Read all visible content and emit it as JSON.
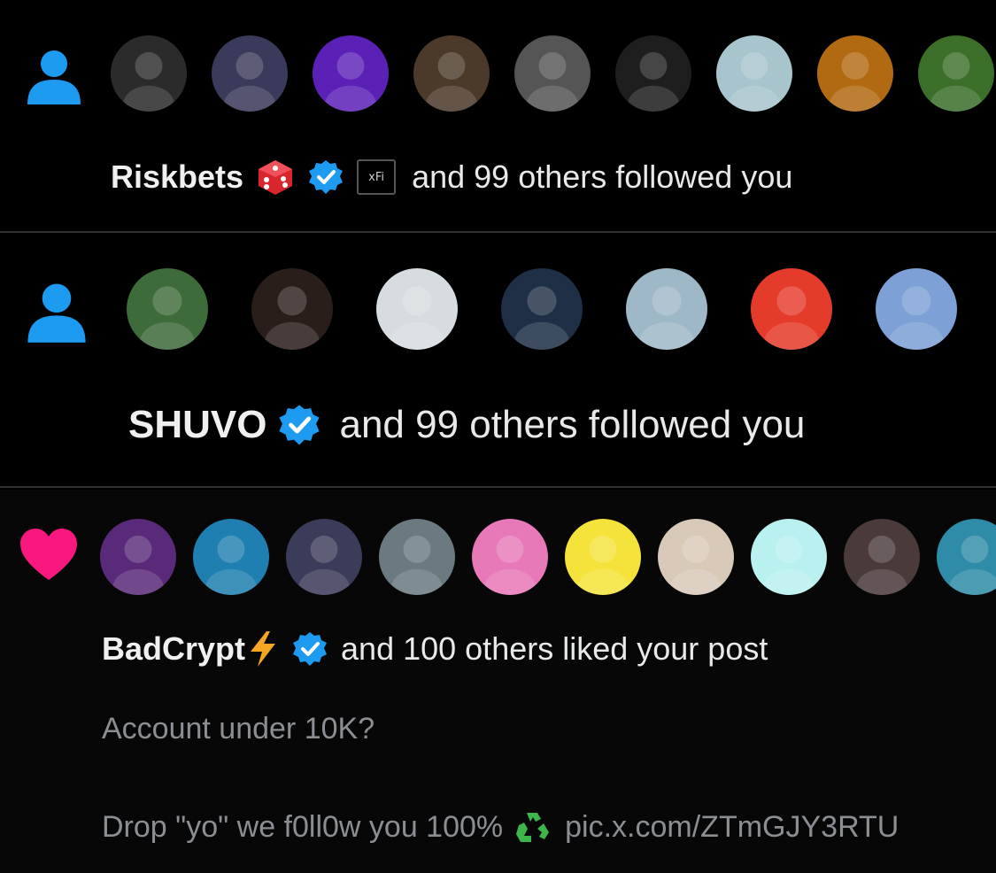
{
  "notifications": [
    {
      "type": "follow",
      "icon": "person-icon",
      "user": "Riskbets",
      "emoji": "🎲",
      "badge_text": "xFi",
      "text": "and 99 others followed you",
      "avatars": [
        "#2b2b2b",
        "#3a3a5a",
        "#5b21b6",
        "#4b3a2a",
        "#555555",
        "#1e1e1e",
        "#a8c4cc",
        "#b26a12",
        "#3b6f2a"
      ]
    },
    {
      "type": "follow",
      "icon": "person-icon",
      "user": "SHUVO",
      "text": "and 99 others followed you",
      "avatars": [
        "#3d6b3a",
        "#2a1e1a",
        "#d6dce0",
        "#1f2f45",
        "#9fb8c8",
        "#e53b2a",
        "#7da0d6"
      ]
    },
    {
      "type": "like",
      "icon": "heart-icon",
      "user": "BadCrypt",
      "emoji": "⚡",
      "text": "and 100 others liked your post",
      "post_line1": "Account under 10K?",
      "post_line2_prefix": "Drop \"yo\" we f0ll0w you 100%",
      "post_line2_emoji": "♻️",
      "post_line2_link": "pic.x.com/ZTmGJY3RTU",
      "avatars": [
        "#5a2a7a",
        "#1f7fb0",
        "#3b3b5a",
        "#6a7a80",
        "#e879b8",
        "#f5e33b",
        "#d9c9b8",
        "#b9f0f0",
        "#4a3a3a",
        "#2f8ca8"
      ]
    }
  ],
  "colors": {
    "accent_blue": "#1d9bf0",
    "like_pink": "#f91880",
    "verified_blue": "#1d9bf0",
    "muted_text": "#8b8f94"
  }
}
